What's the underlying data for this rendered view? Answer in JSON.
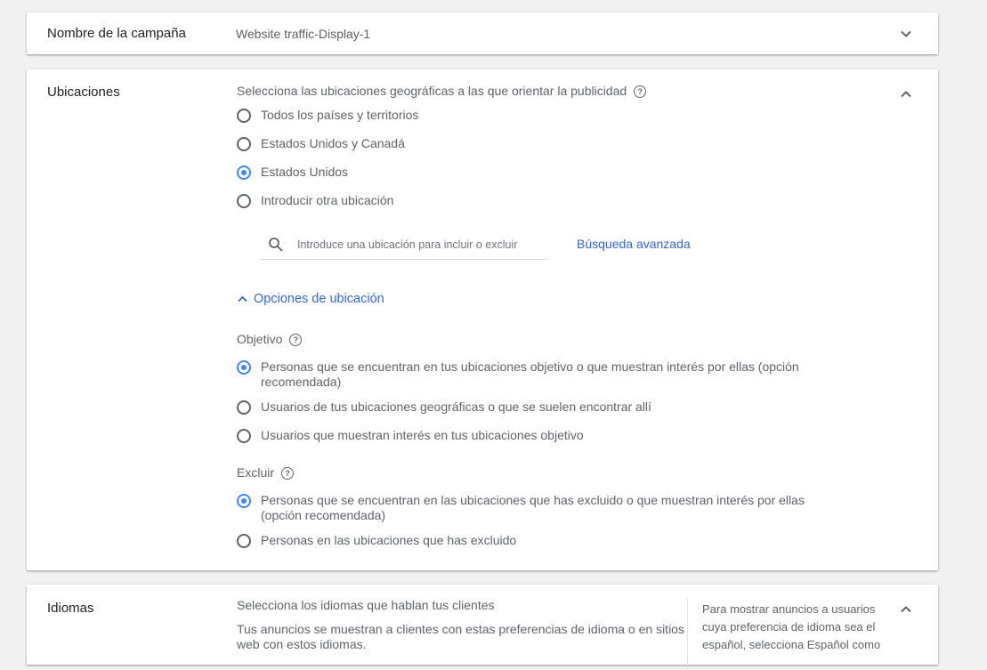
{
  "campaign_name": {
    "label": "Nombre de la campaña",
    "value": "Website traffic-Display-1"
  },
  "locations": {
    "label": "Ubicaciones",
    "prompt": "Selecciona las ubicaciones geográficas a las que orientar la publicidad",
    "options": [
      {
        "label": "Todos los países y territorios",
        "checked": false
      },
      {
        "label": "Estados Unidos y Canadá",
        "checked": false
      },
      {
        "label": "Estados Unidos",
        "checked": true
      },
      {
        "label": "Introducir otra ubicación",
        "checked": false
      }
    ],
    "search_placeholder": "Introduce una ubicación para incluir o excluir",
    "advanced_search": "Búsqueda avanzada",
    "location_options_toggle": "Opciones de ubicación",
    "target": {
      "label": "Objetivo",
      "options": [
        {
          "label": "Personas que se encuentran en tus ubicaciones objetivo o que muestran interés por ellas (opción recomendada)",
          "checked": true
        },
        {
          "label": "Usuarios de tus ubicaciones geográficas o que se suelen encontrar allí",
          "checked": false
        },
        {
          "label": "Usuarios que muestran interés en tus ubicaciones objetivo",
          "checked": false
        }
      ]
    },
    "exclude": {
      "label": "Excluir",
      "options": [
        {
          "label": "Personas que se encuentran en las ubicaciones que has excluido o que muestran interés por ellas (opción recomendada)",
          "checked": true
        },
        {
          "label": "Personas en las ubicaciones que has excluido",
          "checked": false
        }
      ]
    }
  },
  "languages": {
    "label": "Idiomas",
    "prompt": "Selecciona los idiomas que hablan tus clientes",
    "description": "Tus anuncios se muestran a clientes con estas preferencias de idioma o en sitios web con estos idiomas.",
    "sidebar_note": "Para mostrar anuncios a usuarios cuya preferencia de idioma sea el español, selecciona Español como"
  },
  "icons": {
    "expand": "chevron-down-icon",
    "collapse": "chevron-up-icon",
    "help": "help-icon",
    "search": "search-icon"
  },
  "colors": {
    "accent": "#4285f4",
    "link": "#3367d6",
    "background": "#f1f1f1"
  }
}
